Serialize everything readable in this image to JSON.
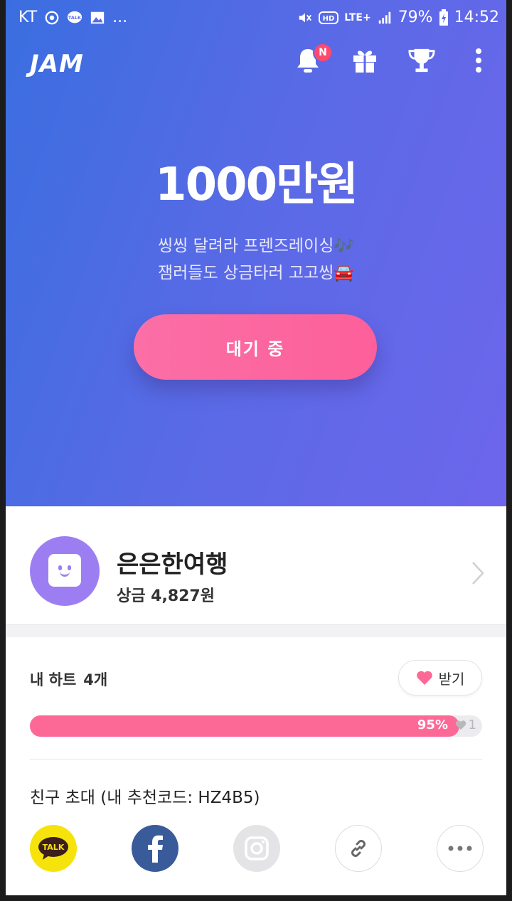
{
  "status_bar": {
    "carrier": "KT",
    "network": "LTE+",
    "battery": "79%",
    "time": "14:52",
    "more": "..."
  },
  "header": {
    "logo": "JAM",
    "notification_badge": "N",
    "icons": [
      "bell-icon",
      "gift-icon",
      "trophy-icon",
      "more-vertical-icon"
    ]
  },
  "hero": {
    "prize": "1000만원",
    "desc_line1": "씽씽 달려라 프렌즈레이싱🎶",
    "desc_line2": "잼러들도 상금타러 고고씽🚘",
    "button_label": "대기 중"
  },
  "profile": {
    "nickname": "은은한여행",
    "reward_label": "상금",
    "reward_value": "4,827원"
  },
  "hearts": {
    "label": "내 하트",
    "count": "4개",
    "receive_label": "받기",
    "progress_percent_text": "95%",
    "progress_fraction": 0.95,
    "next_count": "1"
  },
  "invite": {
    "label": "친구 초대 (내 추천코드: HZ4B5)"
  },
  "share": {
    "kakao_label": "TALK",
    "items": [
      "kakaotalk-icon",
      "facebook-icon",
      "instagram-icon",
      "link-icon",
      "more-horizontal-icon"
    ]
  },
  "colors": {
    "accent_pink": "#fd6996",
    "hero_start": "#3a6ee0",
    "hero_end": "#6d66ec",
    "avatar": "#9d7ef2",
    "kakao": "#f6e30b",
    "facebook": "#3a5b9a"
  }
}
